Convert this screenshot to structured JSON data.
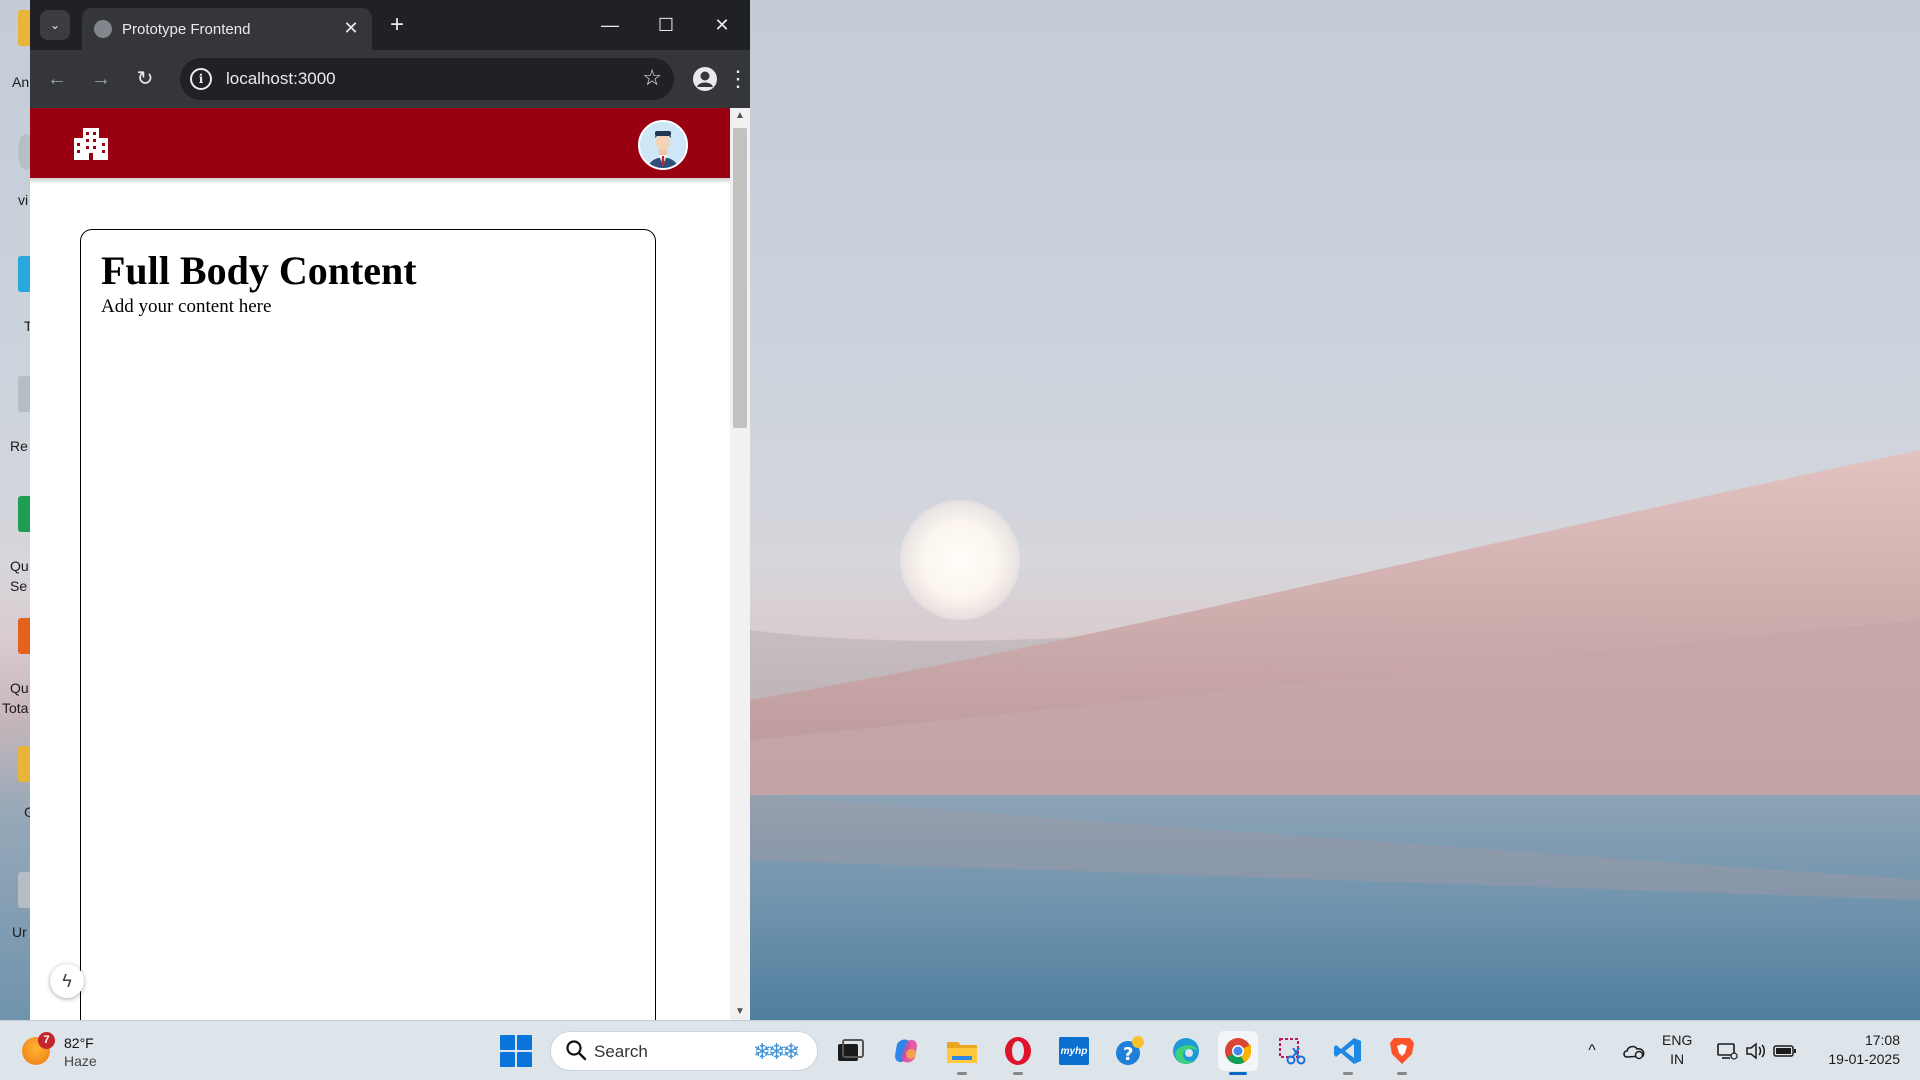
{
  "desktop": {
    "icons": [
      {
        "label": "An",
        "color": "#e8b53a"
      },
      {
        "label": "vi",
        "color": "#9aa4ad"
      },
      {
        "label": "T",
        "color": "#2aa8de"
      },
      {
        "label": "Re",
        "color": "#9aa4ad"
      },
      {
        "label": "Qu",
        "sublabel": "Se",
        "color": "#1f9d55"
      },
      {
        "label": "Qu",
        "sublabel": "Tota",
        "color": "#e3621d"
      },
      {
        "label": "G",
        "color": "#e8b53a"
      },
      {
        "label": "Ur",
        "color": "#9aa4ad"
      }
    ]
  },
  "browser": {
    "tab": {
      "title": "Prototype Frontend",
      "close_glyph": "✕"
    },
    "new_tab_glyph": "+",
    "tab_search_glyph": "⌄",
    "window_controls": {
      "minimize": "—",
      "maximize": "☐",
      "close": "✕"
    },
    "nav": {
      "back": "←",
      "forward": "→",
      "reload": "↻"
    },
    "omnibox": {
      "url": "localhost:3000",
      "info_glyph": "i",
      "star_glyph": "☆"
    },
    "menu_glyph": "⋮",
    "scrollbar": {
      "up": "▲",
      "down": "▼"
    }
  },
  "app": {
    "header_color": "#990012",
    "logo_icon": "building-icon",
    "avatar_icon": "user-avatar-icon",
    "card": {
      "title": "Full Body Content",
      "body": "Add your content here"
    },
    "devtools_glyph": "ϟ"
  },
  "taskbar": {
    "weather": {
      "temp": "82°F",
      "condition": "Haze",
      "badge": "7"
    },
    "search": {
      "placeholder": "Search"
    },
    "apps": [
      {
        "name": "task-view",
        "icon": "task-view-icon"
      },
      {
        "name": "copilot",
        "icon": "copilot-icon"
      },
      {
        "name": "file-explorer",
        "icon": "folder-icon"
      },
      {
        "name": "opera",
        "icon": "opera-icon"
      },
      {
        "name": "myhp",
        "icon": "myhp-icon",
        "text": "myhp"
      },
      {
        "name": "help",
        "icon": "help-icon"
      },
      {
        "name": "edge",
        "icon": "edge-icon"
      },
      {
        "name": "chrome",
        "icon": "chrome-icon"
      },
      {
        "name": "snipping-tool",
        "icon": "scissors-icon"
      },
      {
        "name": "vscode",
        "icon": "vscode-icon"
      },
      {
        "name": "brave",
        "icon": "brave-icon"
      }
    ],
    "tray": {
      "chevron": "^",
      "lang_top": "ENG",
      "lang_bottom": "IN",
      "time": "17:08",
      "date": "19-01-2025"
    }
  }
}
